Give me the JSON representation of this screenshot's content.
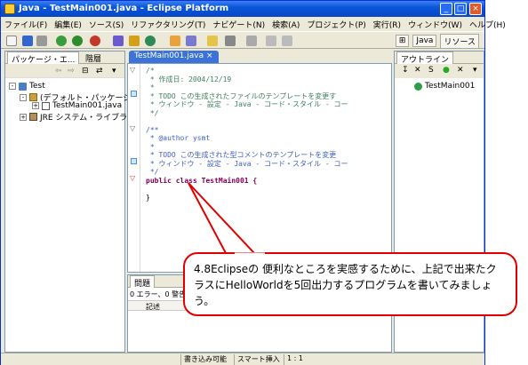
{
  "window": {
    "title": "Java - TestMain001.java - Eclipse Platform"
  },
  "menu": [
    "ファイル(F)",
    "編集(E)",
    "ソース(S)",
    "リファクタリング(T)",
    "ナビゲート(N)",
    "検索(A)",
    "プロジェクト(P)",
    "実行(R)",
    "ウィンドウ(W)",
    "ヘルプ(H)"
  ],
  "perspectives": {
    "java": "Java",
    "resource": "リソース"
  },
  "left_panel": {
    "tab_package": "パッケージ・エ...",
    "tab_hierarchy": "階層",
    "tree": {
      "project": "Test",
      "default_package": "(デフォルト・パッケージ)",
      "file": "TestMain001.java",
      "jre": "JRE システム・ライブラリー ["
    }
  },
  "editor": {
    "tab": "TestMain001.java",
    "lines": [
      "/*",
      " * 作成日: 2004/12/19",
      " *",
      " * TODO この生成されたファイルのテンプレートを変更す",
      " * ウィンドウ - 設定 - Java - コード・スタイル - コー",
      " */",
      "",
      "/**",
      " * @author ysmt",
      " *",
      " * TODO この生成された型コメントのテンプレートを変更",
      " * ウィンドウ - 設定 - Java - コード・スタイル - コー",
      " */",
      "public class TestMain001 {",
      "",
      "}"
    ]
  },
  "outline": {
    "tab": "アウトライン",
    "item": "TestMain001"
  },
  "problems": {
    "tab": "問題",
    "summary": "0 エラー、0 警告、",
    "column": "記述"
  },
  "statusbar": {
    "writable": "書き込み可能",
    "insert": "スマート挿入",
    "position": "1 : 1"
  },
  "callout": {
    "text": "4.8Eclipseの 便利なところを実感するために、上記で出来たクラスにHelloWorldを5回出力するプログラムを書いてみましょう。"
  }
}
